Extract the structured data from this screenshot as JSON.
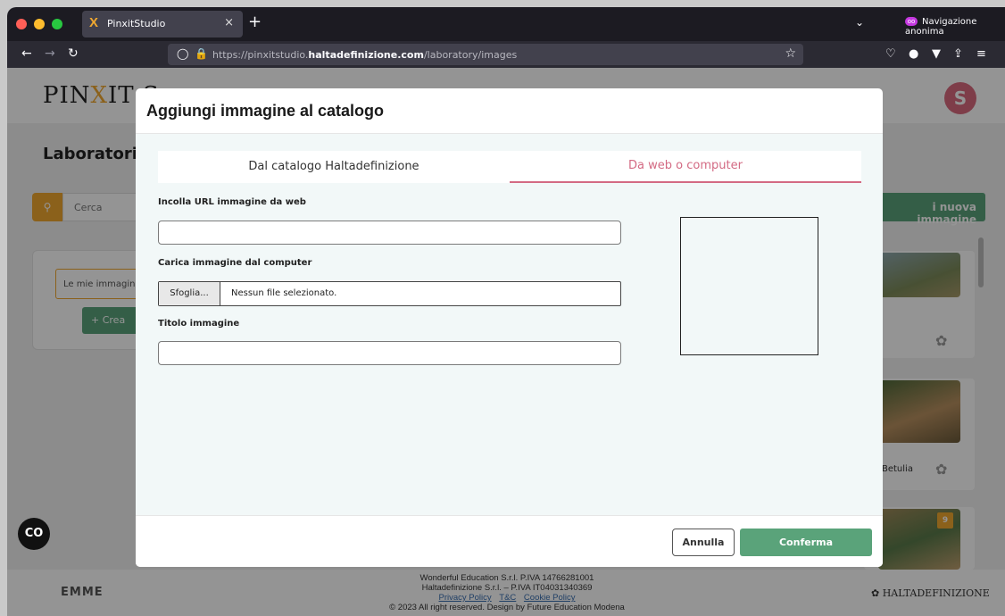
{
  "browser": {
    "tab_title": "PinxitStudio",
    "tab_close": "×",
    "new_tab": "+",
    "private_label": "Navigazione anonima",
    "url_prefix": "https://pinxitstudio.",
    "url_domain": "haltadefinizione.com",
    "url_path": "/laboratory/images"
  },
  "page": {
    "logo_prefix": "PIN",
    "logo_x": "X",
    "logo_suffix": "IT S",
    "avatar_letter": "S",
    "title": "Laboratorio",
    "search_placeholder": "Cerca",
    "my_images": "Le mie immagini (",
    "create_label": "+ Crea",
    "new_image_label": "i nuova immagine",
    "card_caption": "Betulia",
    "badge": "9"
  },
  "footer": {
    "line1": "Wonderful Education S.r.l. P.IVA 14766281001",
    "line2": "Haltadefinizione S.r.l. – P.IVA IT04031340369",
    "links": [
      "Privacy Policy",
      "T&C",
      "Cookie Policy"
    ],
    "line4": "© 2023 All right reserved. Design by Future Education Modena",
    "left_logo": "EMME",
    "right_logo": "HALTADEFINIZIONE",
    "cc_label": "CO"
  },
  "modal": {
    "title": "Aggiungi immagine al catalogo",
    "tabs": [
      "Dal catalogo Haltadefinizione",
      "Da web o computer"
    ],
    "active_tab": 1,
    "url_label": "Incolla URL immagine da web",
    "url_value": "",
    "upload_label": "Carica immagine dal computer",
    "browse_button": "Sfoglia...",
    "file_status": "Nessun file selezionato.",
    "title_label": "Titolo immagine",
    "title_value": "",
    "cancel": "Annulla",
    "confirm": "Conferma"
  },
  "colors": {
    "accent_pink": "#d36a83",
    "confirm_green": "#5aa37a",
    "brand_orange": "#f0a830"
  }
}
